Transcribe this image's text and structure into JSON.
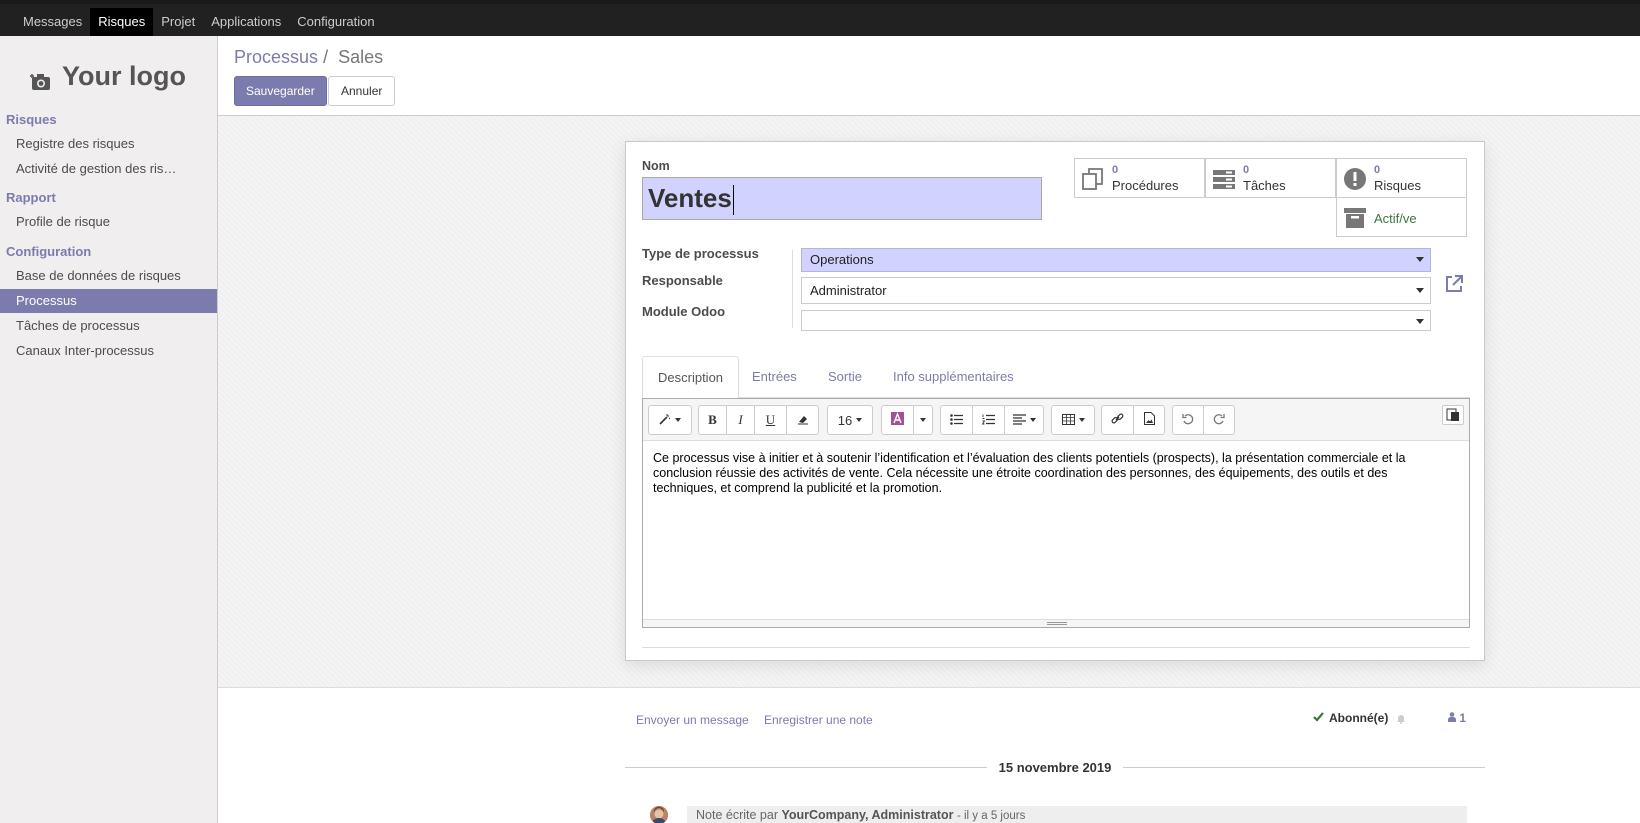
{
  "topbar": {
    "menu": [
      "Messages",
      "Risques",
      "Projet",
      "Applications",
      "Configuration"
    ],
    "active_index": 1
  },
  "sidebar": {
    "logo_text": "Your logo",
    "sections": [
      {
        "title": "Risques",
        "items": [
          "Registre des risques",
          "Activité de gestion des ris…"
        ]
      },
      {
        "title": "Rapport",
        "items": [
          "Profile de risque"
        ]
      },
      {
        "title": "Configuration",
        "items": [
          "Base de données de risques",
          "Processus",
          "Tâches de processus",
          "Canaux Inter-processus"
        ]
      }
    ],
    "active_item": "Processus"
  },
  "breadcrumb": {
    "parent": "Processus",
    "separator": "/",
    "current": "Sales"
  },
  "actions": {
    "save": "Sauvegarder",
    "cancel": "Annuler"
  },
  "form": {
    "name_label": "Nom",
    "name_value": "Ventes",
    "smart_buttons": [
      {
        "count": "0",
        "label": "Procédures",
        "icon": "documents-icon"
      },
      {
        "count": "0",
        "label": "Tâches",
        "icon": "tasks-icon"
      },
      {
        "count": "0",
        "label": "Risques",
        "icon": "exclamation-icon"
      }
    ],
    "active_toggle": {
      "label": "Actif/ve",
      "icon": "archive-icon"
    },
    "fields": [
      {
        "label": "Type de processus",
        "value": "Operations"
      },
      {
        "label": "Responsable",
        "value": "Administrator"
      },
      {
        "label": "Module Odoo",
        "value": ""
      }
    ],
    "tabs": [
      "Description",
      "Entrées",
      "Sortie",
      "Info supplémentaires"
    ],
    "active_tab": "Description",
    "editor": {
      "font_size": "16",
      "text": "Ce processus vise à initier et à soutenir l’identification et l’évaluation des clients potentiels (prospects), la présentation commerciale et la conclusion réussie des activités de vente. Cela nécessite une étroite coordination des personnes, des équipements, des outils et des techniques, et comprend la publicité et la promotion."
    }
  },
  "chatter": {
    "send_message": "Envoyer un message",
    "log_note": "Enregistrer une note",
    "follow_label": "Abonné(e)",
    "followers_count": "1",
    "date_separator": "15 novembre 2019",
    "note": {
      "prefix": "Note écrite par",
      "author": "YourCompany, Administrator",
      "suffix": "- il y a 5 jours"
    }
  },
  "colors": {
    "brand": "#7c7bad",
    "selected_field": "#d2d2ff",
    "active_green": "#3c763d"
  }
}
